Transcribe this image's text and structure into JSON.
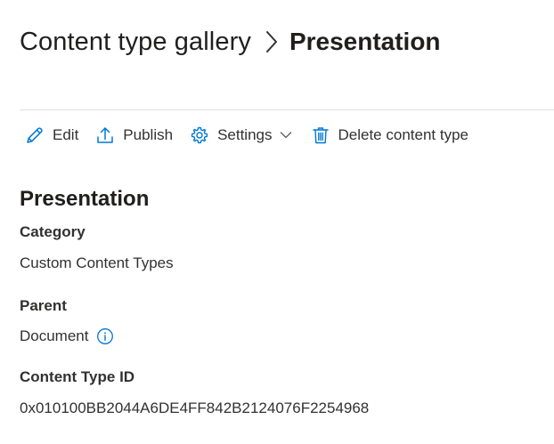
{
  "breadcrumb": {
    "parent": "Content type gallery",
    "current": "Presentation"
  },
  "toolbar": {
    "edit": "Edit",
    "publish": "Publish",
    "settings": "Settings",
    "delete": "Delete content type"
  },
  "details": {
    "title": "Presentation",
    "category_label": "Category",
    "category_value": "Custom Content Types",
    "parent_label": "Parent",
    "parent_value": "Document",
    "id_label": "Content Type ID",
    "id_value": "0x010100BB2044A6DE4FF842B2124076F2254968"
  },
  "colors": {
    "accent": "#0078d4",
    "text": "#323130",
    "divider": "#e1dfdd"
  },
  "icons": {
    "edit": "pencil-icon",
    "publish": "upload-icon",
    "settings": "gear-icon",
    "settings_menu": "chevron-down-icon",
    "delete": "trash-icon",
    "parent_info": "info-icon"
  }
}
